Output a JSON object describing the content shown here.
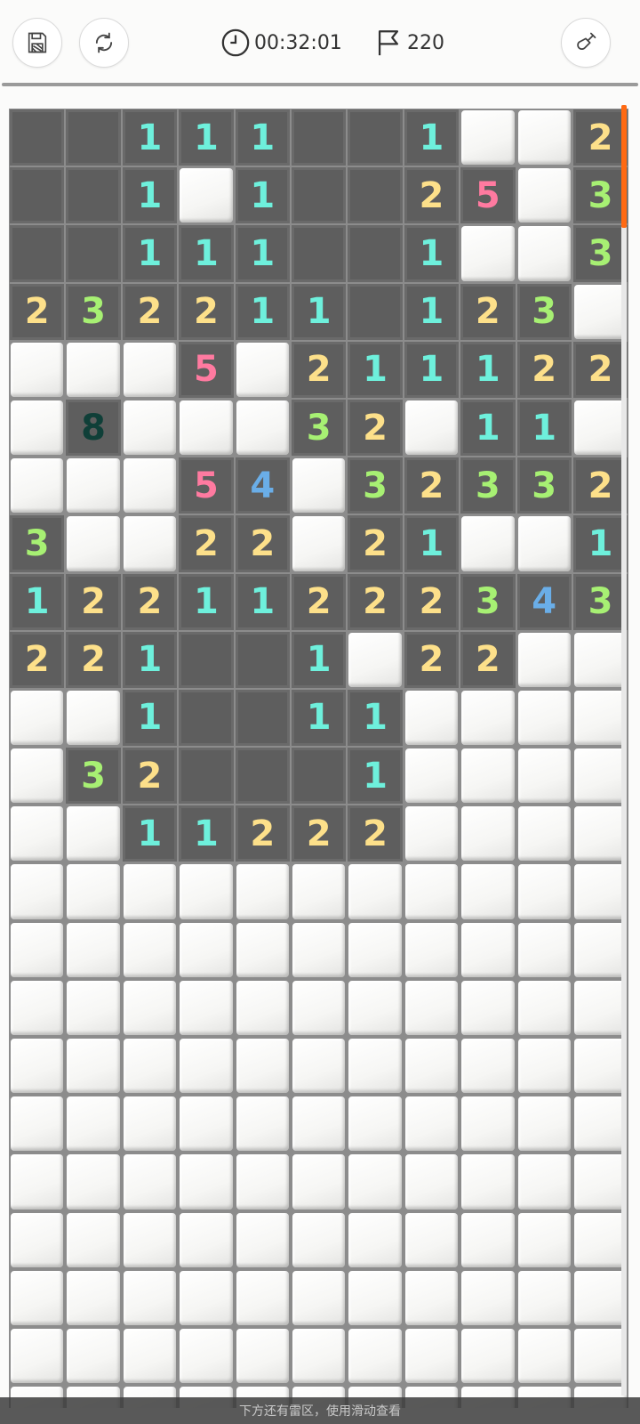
{
  "header": {
    "save_icon": "floppy-disk-icon",
    "restart_icon": "refresh-icon",
    "timer_icon": "clock-icon",
    "timer": "00:32:01",
    "flag_icon": "flag-icon",
    "flags": "220",
    "tool_icon": "shovel-icon"
  },
  "colors": {
    "1": "#6ef0dc",
    "2": "#fde08a",
    "3": "#a7f073",
    "4": "#6aaee8",
    "5": "#ff7aa0",
    "8": "#0f3f38",
    "accent": "#ff6a13"
  },
  "board": {
    "rows": [
      "RR111RR1HH2",
      "RR1H1RR25H3",
      "RR111RR1HH3",
      "232211R123H",
      "HHH5H211122",
      "H8HHH32H11H",
      "HHH54H32332",
      "3HH22H21HH1",
      "12211222343",
      "221RR1H22HH",
      "HH1RR11HHHH",
      "H32RRR1HHHH",
      "HH11222HHHH",
      "HHHHHHHHHHH",
      "HHHHHHHHHHH",
      "HHHHHHHHHHH",
      "HHHHHHHHHHH",
      "HHHHHHHHHHH",
      "HHHHHHHHHHH",
      "HHHHHHHHHHH",
      "HHHHHHHHHHH",
      "HHHHHHHHHHH",
      "HHHHHHHHHHH"
    ]
  },
  "footer": {
    "hint": "下方还有雷区，使用滑动查看"
  }
}
